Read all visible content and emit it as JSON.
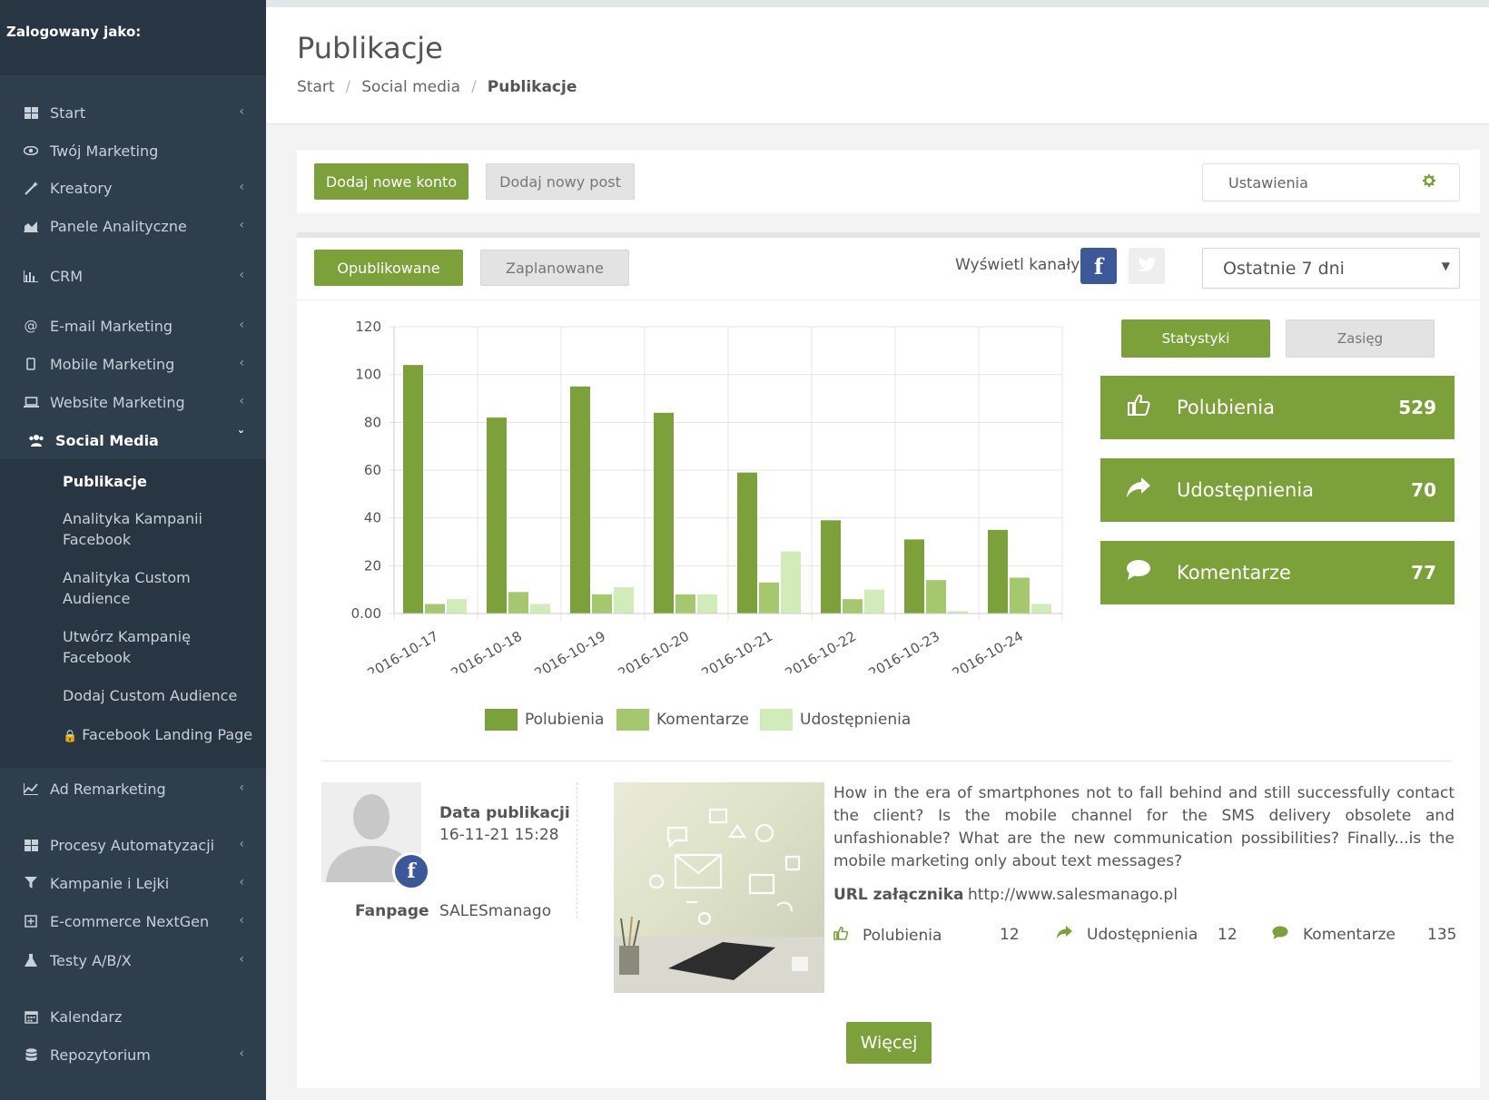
{
  "sidebar": {
    "user_label": "Zalogowany jako:",
    "items": [
      {
        "label": "Start",
        "icon": "grid-icon"
      },
      {
        "label": "Twój Marketing",
        "icon": "eye-icon"
      },
      {
        "label": "Kreatory",
        "icon": "wand-icon"
      },
      {
        "label": "Panele Analityczne",
        "icon": "area-chart-icon"
      },
      {
        "label": "CRM",
        "icon": "bar-chart-icon"
      },
      {
        "label": "E-mail Marketing",
        "icon": "at-icon"
      },
      {
        "label": "Mobile Marketing",
        "icon": "mobile-icon"
      },
      {
        "label": "Website Marketing",
        "icon": "laptop-icon"
      },
      {
        "label": "Social Media",
        "icon": "users-icon"
      },
      {
        "label": "Ad Remarketing",
        "icon": "line-chart-icon"
      },
      {
        "label": "Procesy Automatyzacji",
        "icon": "grid-icon"
      },
      {
        "label": "Kampanie i Lejki",
        "icon": "filter-icon"
      },
      {
        "label": "E-commerce NextGen",
        "icon": "plus-square-icon"
      },
      {
        "label": "Testy A/B/X",
        "icon": "flask-icon"
      },
      {
        "label": "Kalendarz",
        "icon": "calendar-icon"
      },
      {
        "label": "Repozytorium",
        "icon": "database-icon"
      }
    ],
    "sub_items": [
      {
        "label": "Publikacje"
      },
      {
        "label": "Analityka Kampanii Facebook"
      },
      {
        "label": "Analityka Custom Audience"
      },
      {
        "label": "Utwórz Kampanię Facebook"
      },
      {
        "label": "Dodaj Custom Audience"
      },
      {
        "label": "Facebook Landing Page"
      }
    ]
  },
  "header": {
    "title": "Publikacje",
    "breadcrumb": [
      "Start",
      "Social media",
      "Publikacje"
    ]
  },
  "actions": {
    "add_account": "Dodaj nowe konto",
    "add_post": "Dodaj nowy post",
    "settings": "Ustawienia"
  },
  "filters": {
    "published": "Opublikowane",
    "scheduled": "Zaplanowane",
    "channels_label": "Wyświetl kanały",
    "period": "Ostatnie 7 dni"
  },
  "stats_tabs": {
    "stats": "Statystyki",
    "reach": "Zasięg"
  },
  "stat_cards": [
    {
      "label": "Polubienia",
      "value": "529",
      "icon": "thumbs-up-icon"
    },
    {
      "label": "Udostępnienia",
      "value": "70",
      "icon": "share-icon"
    },
    {
      "label": "Komentarze",
      "value": "77",
      "icon": "comment-icon"
    }
  ],
  "chart_data": {
    "type": "bar",
    "categories": [
      "2016-10-17",
      "2016-10-18",
      "2016-10-19",
      "2016-10-20",
      "2016-10-21",
      "2016-10-22",
      "2016-10-23",
      "2016-10-24"
    ],
    "series": [
      {
        "name": "Polubienia",
        "values": [
          104,
          82,
          95,
          84,
          59,
          39,
          31,
          35
        ],
        "color": "#7da13a"
      },
      {
        "name": "Komentarze",
        "values": [
          4,
          9,
          8,
          8,
          13,
          6,
          14,
          15
        ],
        "color": "#a5c86e"
      },
      {
        "name": "Udostępnienia",
        "values": [
          6,
          4,
          11,
          8,
          26,
          10,
          1,
          4
        ],
        "color": "#d1ecb8"
      }
    ],
    "y_ticks": [
      "0.00",
      "20",
      "40",
      "60",
      "80",
      "100",
      "120"
    ],
    "ylim": [
      0,
      120
    ],
    "grid": true,
    "legend": "bottom"
  },
  "post": {
    "date_label": "Data publikacji",
    "date_value": "16-11-21 15:28",
    "fanpage_label": "Fanpage",
    "fanpage_value": "SALESmanago",
    "text": "How in the era of smartphones not to fall behind and still successfully contact the client? Is the mobile channel for the SMS delivery obsolete and unfashionable? What are the new communication possibilities? Finally...is the mobile marketing only about text messages?",
    "url_label": "URL załącznika",
    "url_value": "http://www.salesmanago.pl",
    "likes_label": "Polubienia",
    "likes_value": "12",
    "shares_label": "Udostępnienia",
    "shares_value": "12",
    "comments_label": "Komentarze",
    "comments_value": "135",
    "more": "Więcej"
  }
}
